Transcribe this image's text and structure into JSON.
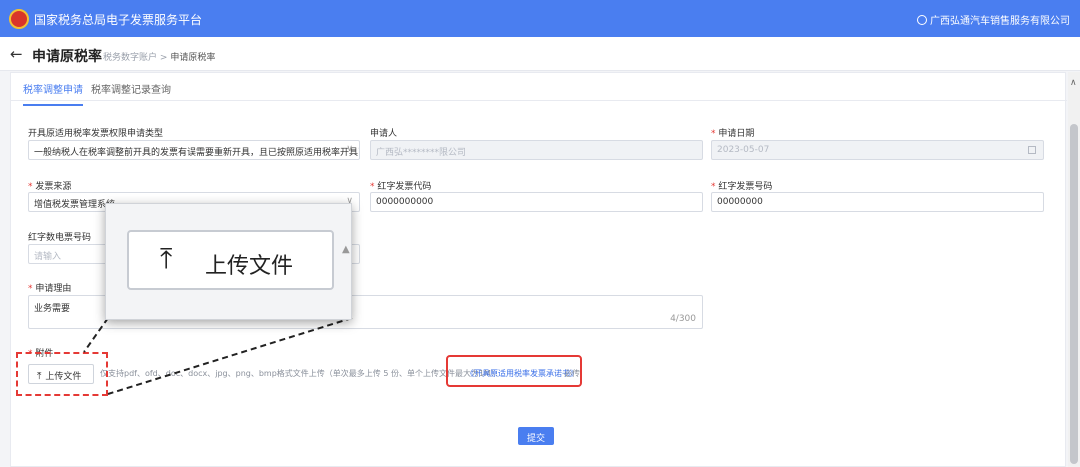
{
  "app": {
    "title": "国家税务总局电子发票服务平台",
    "user": "广西弘通汽车销售服务有限公司"
  },
  "header": {
    "back_icon": "arrow-left-icon",
    "title": "申请原税率",
    "breadcrumb": [
      "税务数字账户",
      "申请原税率"
    ],
    "separator": ">"
  },
  "tabs": [
    {
      "label": "税率调整申请",
      "active": true
    },
    {
      "label": "税率调整记录查询",
      "active": false
    }
  ],
  "form": {
    "application_type": {
      "label": "开具原适用税率发票权限申请类型",
      "value": "一般纳税人在税率调整前开具的发票有误需要重新开具，且已按照原适用税率开具了"
    },
    "applicant": {
      "label": "申请人",
      "value": "广西弘********限公司"
    },
    "apply_date": {
      "label": "申请日期",
      "value": "2023-05-07"
    },
    "invoice_source": {
      "label": "发票来源",
      "value": "增值税发票管理系统"
    },
    "red_invoice_code": {
      "label": "红字发票代码",
      "value": "0000000000"
    },
    "red_invoice_number": {
      "label": "红字发票号码",
      "value": "00000000"
    },
    "red_e_invoice_number": {
      "label": "红字数电票号码",
      "placeholder": "请输入"
    },
    "reason": {
      "label": "申请理由",
      "value": "业务需要",
      "count": "4/300"
    },
    "attachment": {
      "label": "附件",
      "upload_label": "上传文件",
      "hint": "仅支持pdf、ofd、doc、docx、jpg、png、bmp格式文件上传（单次最多上传 5 份、单个上传文件最大为1M）、",
      "link": "《开具原适用税率发票承诺书》",
      "suffix": "必传"
    },
    "submit_label": "提交"
  },
  "zoom_callout": {
    "upload_label": "上传文件"
  },
  "colors": {
    "primary": "#4a7ef0",
    "highlight": "#e53935"
  }
}
